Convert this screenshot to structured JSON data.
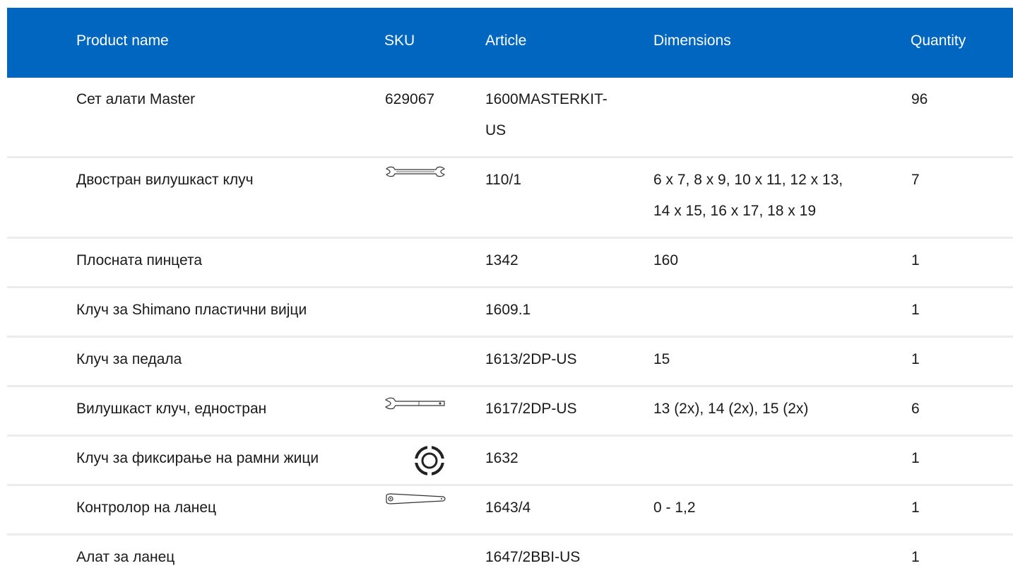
{
  "table": {
    "columns": {
      "name": "Product name",
      "sku": "SKU",
      "article": "Article",
      "dimensions": "Dimensions",
      "quantity": "Quantity"
    },
    "rows": [
      {
        "name": "Сет алати Master",
        "sku": "629067",
        "sku_icon": "",
        "article": "1600MASTERKIT-\nUS",
        "dimensions": "",
        "quantity": "96"
      },
      {
        "name": "Двостран вилушкаст клуч",
        "sku": "",
        "sku_icon": "double-open-end-wrench-icon",
        "article": "110/1",
        "dimensions": "6 x 7, 8 x 9, 10 x 11, 12 x 13,\n14 x 15, 16 x 17, 18 x 19",
        "quantity": "7"
      },
      {
        "name": "Плосната пинцета",
        "sku": "",
        "sku_icon": "",
        "article": "1342",
        "dimensions": "160",
        "quantity": "1"
      },
      {
        "name": "Клуч за Shimano пластични вијци",
        "sku": "",
        "sku_icon": "",
        "article": "1609.1",
        "dimensions": "",
        "quantity": "1"
      },
      {
        "name": "Клуч за педала",
        "sku": "",
        "sku_icon": "",
        "article": "1613/2DP-US",
        "dimensions": "15",
        "quantity": "1"
      },
      {
        "name": "Вилушкаст клуч, еднострaн",
        "sku": "",
        "sku_icon": "open-end-wrench-icon",
        "article": "1617/2DP-US",
        "dimensions": "13 (2x), 14 (2x), 15 (2x)",
        "quantity": "6"
      },
      {
        "name": "Клуч за фиксирање на рамни жици",
        "sku": "",
        "sku_icon": "spoke-nipple-wrench-icon",
        "article": "1632",
        "dimensions": "",
        "quantity": "1"
      },
      {
        "name": "Контролор на ланец",
        "sku": "",
        "sku_icon": "chain-checker-icon",
        "article": "1643/4",
        "dimensions": "0 - 1,2",
        "quantity": "1"
      },
      {
        "name": "Алат за ланец",
        "sku": "",
        "sku_icon": "",
        "article": "1647/2BBI-US",
        "dimensions": "",
        "quantity": "1"
      }
    ]
  },
  "colors": {
    "header_background": "#0066bf",
    "header_text": "#ffffff",
    "row_divider": "#ececec",
    "body_text": "#1a1a1a"
  }
}
